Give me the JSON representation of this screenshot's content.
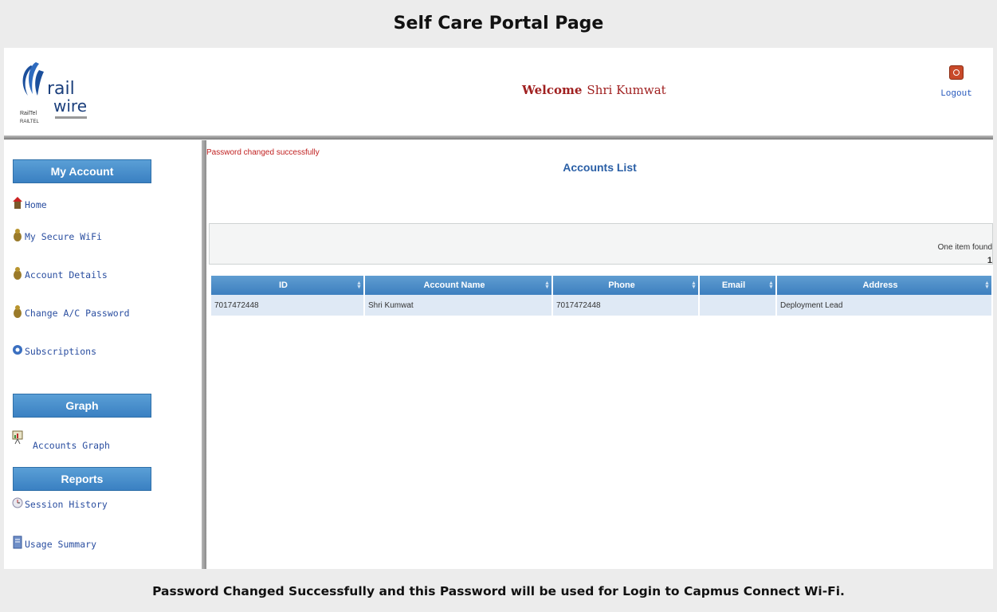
{
  "page_title": "Self Care Portal Page",
  "header": {
    "logo": {
      "brand_line1": "rail",
      "brand_line2": "wire"
    },
    "welcome_label": "Welcome",
    "user_name": "Shri Kumwat",
    "logout_label": "Logout"
  },
  "sidebar": {
    "sections": [
      {
        "title": "My Account",
        "items": [
          {
            "label": "Home",
            "icon": "home-icon"
          },
          {
            "label": "My Secure WiFi",
            "icon": "wifi-icon"
          },
          {
            "label": "Account Details",
            "icon": "account-icon"
          },
          {
            "label": "Change A/C Password",
            "icon": "password-icon"
          },
          {
            "label": "Subscriptions",
            "icon": "subscriptions-icon"
          }
        ]
      },
      {
        "title": "Graph",
        "items": [
          {
            "label": "Accounts Graph",
            "icon": "graph-icon"
          }
        ]
      },
      {
        "title": "Reports",
        "items": [
          {
            "label": "Session History",
            "icon": "history-icon"
          },
          {
            "label": "Usage Summary",
            "icon": "summary-icon"
          }
        ]
      }
    ]
  },
  "main": {
    "status_message": "Password changed successfully",
    "list_title": "Accounts List",
    "pager": {
      "found_text": "One item found",
      "page": "1"
    },
    "table": {
      "columns": [
        "ID",
        "Account Name",
        "Phone",
        "Email",
        "Address"
      ],
      "rows": [
        [
          "7017472448",
          "Shri Kumwat",
          "7017472448",
          "",
          "Deployment Lead"
        ]
      ]
    }
  },
  "footer_note": "Password Changed Successfully and this Password will be used for Login to Capmus Connect Wi-Fi.",
  "colors": {
    "section_header": "#3a80c2",
    "link": "#2a4ea0",
    "welcome": "#a02020",
    "status_message": "#c02020",
    "table_row": "#dfe9f5"
  }
}
